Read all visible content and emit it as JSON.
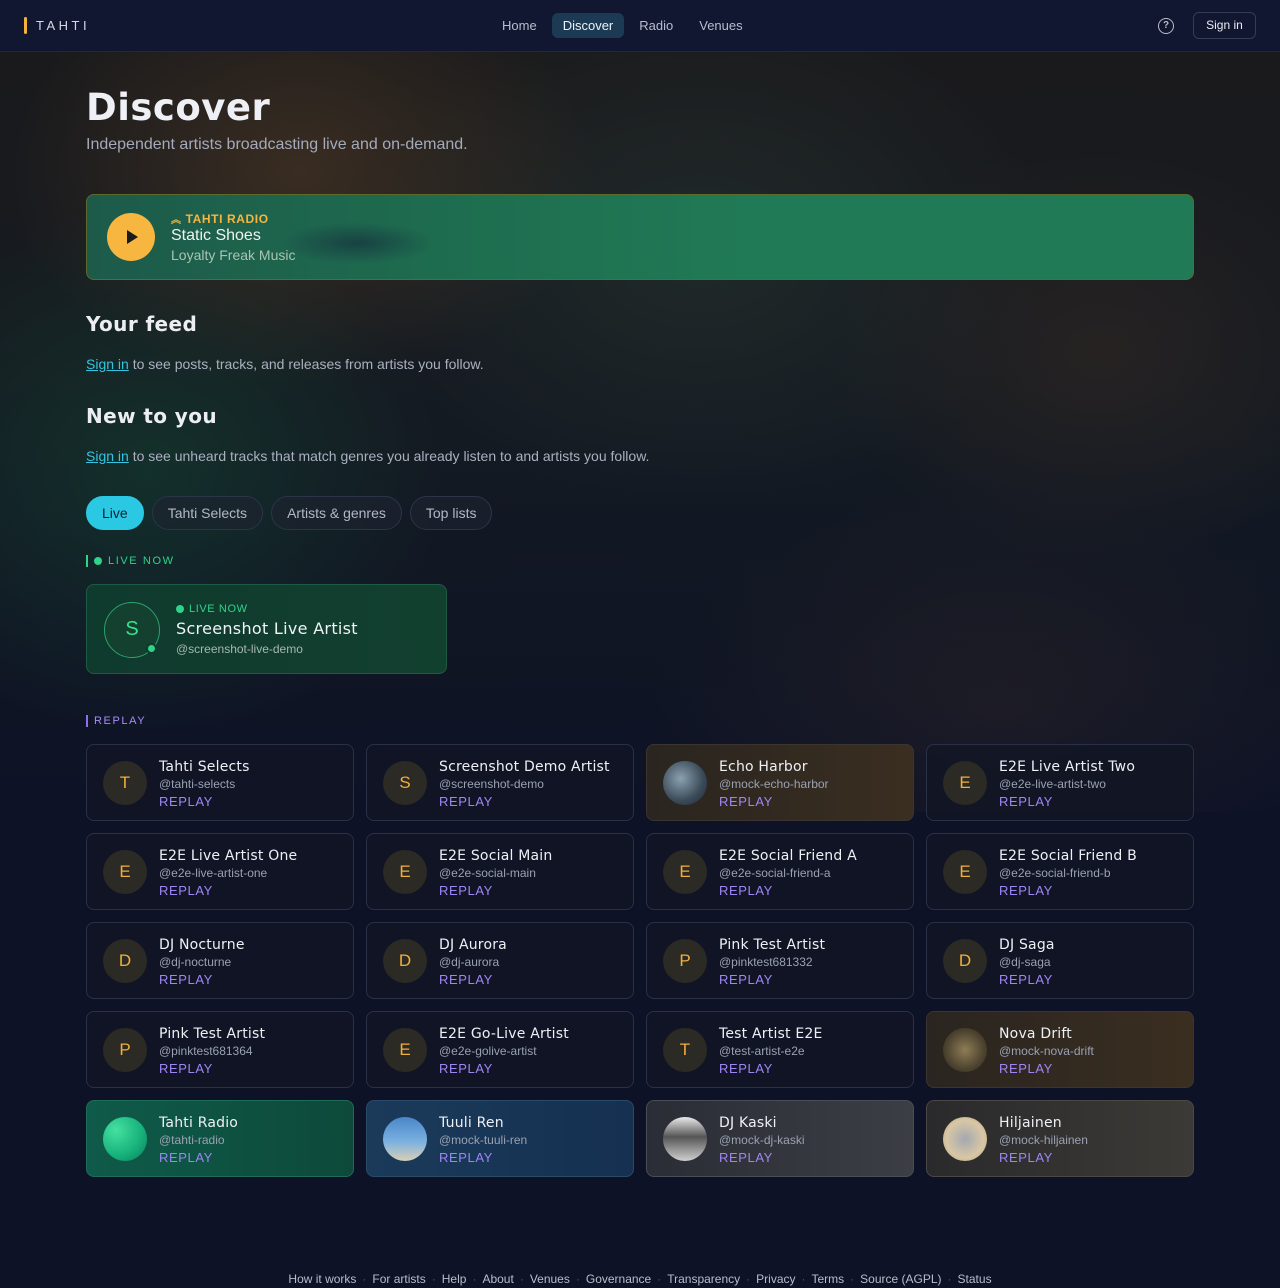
{
  "app": {
    "name": "TAHTI"
  },
  "nav": {
    "items": [
      {
        "label": "Home",
        "active": false
      },
      {
        "label": "Discover",
        "active": true
      },
      {
        "label": "Radio",
        "active": false
      },
      {
        "label": "Venues",
        "active": false
      }
    ],
    "help_icon": "question-circle-icon",
    "signin_label": "Sign in"
  },
  "page": {
    "title": "Discover",
    "subtitle": "Independent artists broadcasting live and on-demand."
  },
  "radio": {
    "kicker": "TAHTI RADIO",
    "title": "Static Shoes",
    "artist": "Loyalty Freak Music",
    "play_icon": "play-icon"
  },
  "feed": {
    "title": "Your feed",
    "signin_link": "Sign in",
    "text": " to see posts, tracks, and releases from artists you follow."
  },
  "new_to_you": {
    "title": "New to you",
    "signin_link": "Sign in",
    "text": " to see unheard tracks that match genres you already listen to and artists you follow."
  },
  "tabs": [
    "Live",
    "Tahti Selects",
    "Artists & genres",
    "Top lists"
  ],
  "live_section": {
    "label": "LIVE NOW",
    "card": {
      "initial": "S",
      "kicker": "LIVE NOW",
      "name": "Screenshot Live Artist",
      "handle": "@screenshot-live-demo"
    }
  },
  "replay_section": {
    "label": "REPLAY",
    "cards": [
      {
        "initial": "T",
        "name": "Tahti Selects",
        "handle": "@tahti-selects",
        "badge": "REPLAY"
      },
      {
        "initial": "S",
        "name": "Screenshot Demo Artist",
        "handle": "@screenshot-demo",
        "badge": "REPLAY"
      },
      {
        "initial": "",
        "name": "Echo Harbor",
        "handle": "@mock-echo-harbor",
        "badge": "REPLAY"
      },
      {
        "initial": "E",
        "name": "E2E Live Artist Two",
        "handle": "@e2e-live-artist-two",
        "badge": "REPLAY"
      },
      {
        "initial": "E",
        "name": "E2E Live Artist One",
        "handle": "@e2e-live-artist-one",
        "badge": "REPLAY"
      },
      {
        "initial": "E",
        "name": "E2E Social Main",
        "handle": "@e2e-social-main",
        "badge": "REPLAY"
      },
      {
        "initial": "E",
        "name": "E2E Social Friend A",
        "handle": "@e2e-social-friend-a",
        "badge": "REPLAY"
      },
      {
        "initial": "E",
        "name": "E2E Social Friend B",
        "handle": "@e2e-social-friend-b",
        "badge": "REPLAY"
      },
      {
        "initial": "D",
        "name": "DJ Nocturne",
        "handle": "@dj-nocturne",
        "badge": "REPLAY"
      },
      {
        "initial": "D",
        "name": "DJ Aurora",
        "handle": "@dj-aurora",
        "badge": "REPLAY"
      },
      {
        "initial": "P",
        "name": "Pink Test Artist",
        "handle": "@pinktest681332",
        "badge": "REPLAY"
      },
      {
        "initial": "D",
        "name": "DJ Saga",
        "handle": "@dj-saga",
        "badge": "REPLAY"
      },
      {
        "initial": "P",
        "name": "Pink Test Artist",
        "handle": "@pinktest681364",
        "badge": "REPLAY"
      },
      {
        "initial": "E",
        "name": "E2E Go-Live Artist",
        "handle": "@e2e-golive-artist",
        "badge": "REPLAY"
      },
      {
        "initial": "T",
        "name": "Test Artist E2E",
        "handle": "@test-artist-e2e",
        "badge": "REPLAY"
      },
      {
        "initial": "",
        "name": "Nova Drift",
        "handle": "@mock-nova-drift",
        "badge": "REPLAY"
      },
      {
        "initial": "",
        "name": "Tahti Radio",
        "handle": "@tahti-radio",
        "badge": "REPLAY"
      },
      {
        "initial": "",
        "name": "Tuuli Ren",
        "handle": "@mock-tuuli-ren",
        "badge": "REPLAY"
      },
      {
        "initial": "",
        "name": "DJ Kaski",
        "handle": "@mock-dj-kaski",
        "badge": "REPLAY"
      },
      {
        "initial": "",
        "name": "Hiljainen",
        "handle": "@mock-hiljainen",
        "badge": "REPLAY"
      }
    ]
  },
  "footer": {
    "links": [
      "How it works",
      "For artists",
      "Help",
      "About",
      "Venues",
      "Governance",
      "Transparency",
      "Privacy",
      "Terms",
      "Source (AGPL)",
      "Status"
    ]
  },
  "colors": {
    "accent": "#2bc8e4",
    "radio_gold": "#f7b640",
    "live_green": "#2fd38a",
    "replay_purple": "#9e86f5"
  }
}
